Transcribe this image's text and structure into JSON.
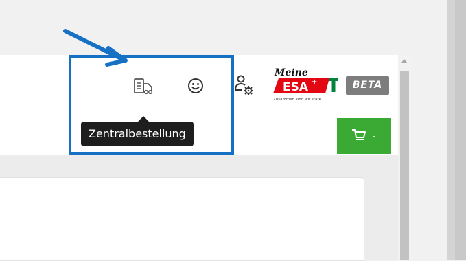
{
  "toolbar": {
    "tooltip_text": "Zentralbestellung",
    "icons": [
      "central-order-icon",
      "smiley-icon",
      "user-settings-icon"
    ]
  },
  "logo": {
    "script_text": "Meine",
    "brand_text": "ESA",
    "tagline": "Zusammen sind wir stark",
    "brand_color": "#e30613",
    "accent_color": "#00843d"
  },
  "badge": {
    "label": "BETA"
  },
  "cart": {
    "count_label": "-",
    "color": "#3aaa35"
  },
  "annotation": {
    "highlight_color": "#1670c4"
  }
}
